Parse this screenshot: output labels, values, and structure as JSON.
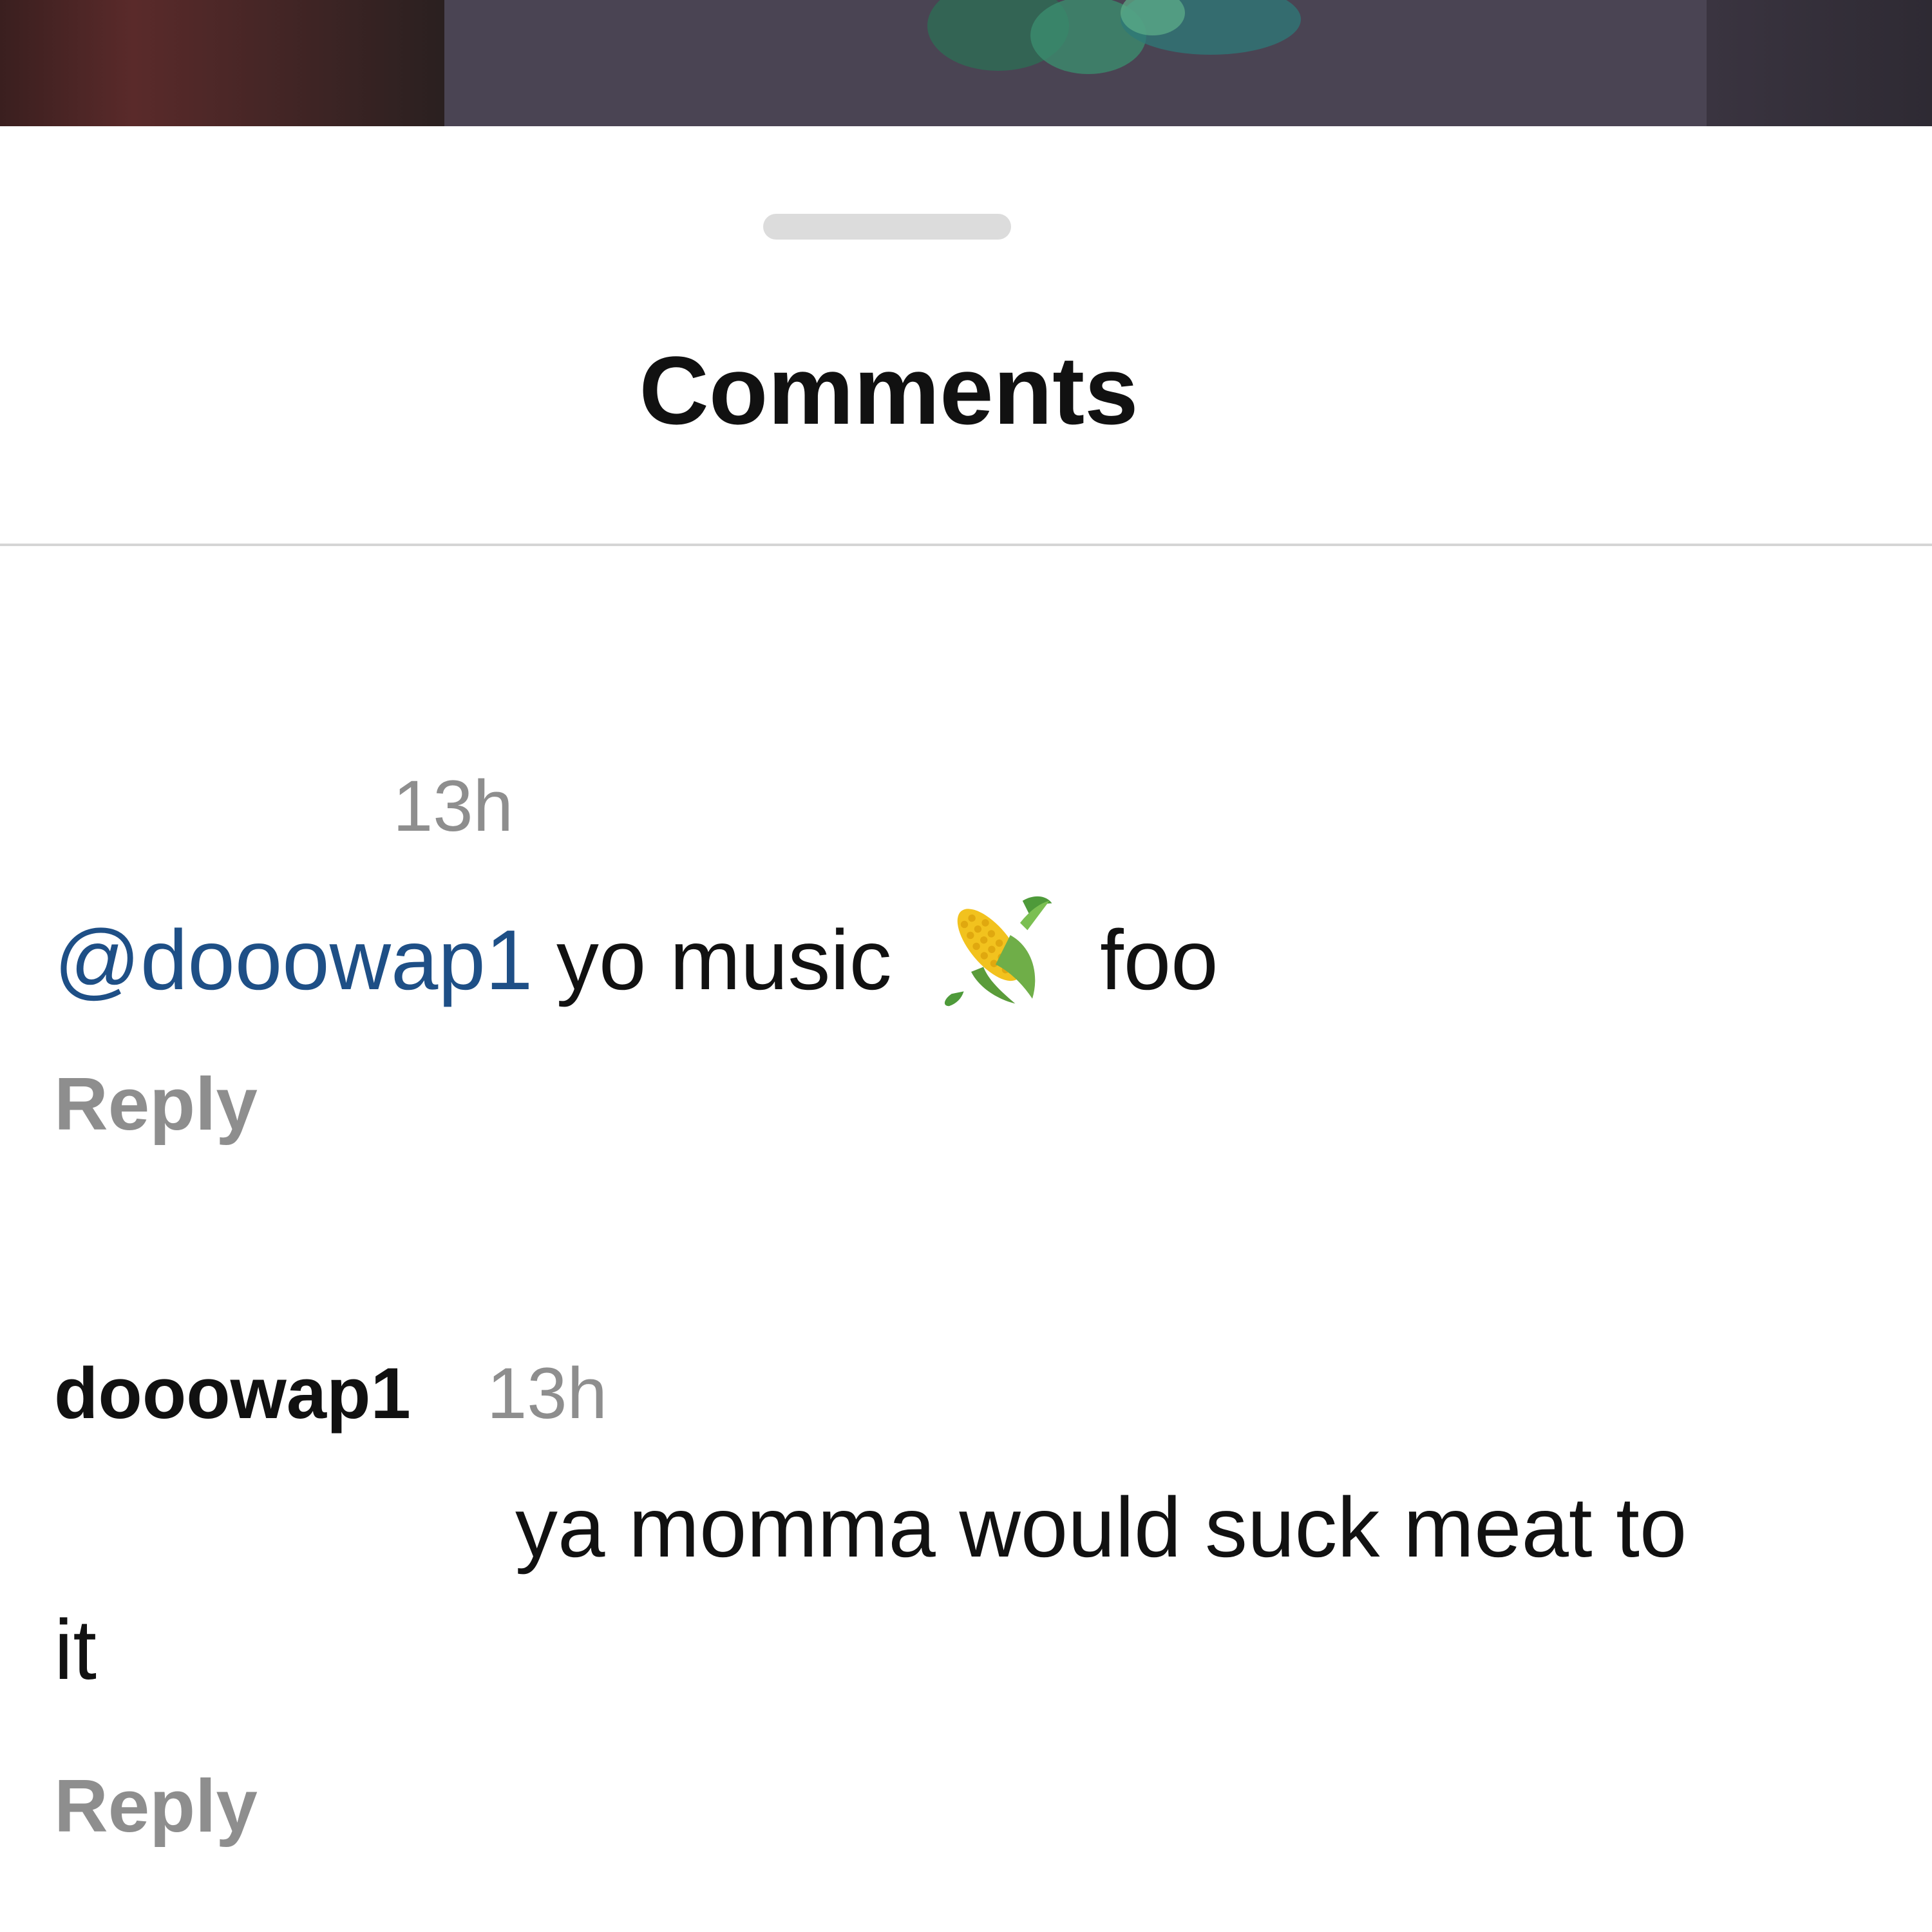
{
  "sheet": {
    "title": "Comments"
  },
  "comments": [
    {
      "timestamp": "13h",
      "mention": "@dooowap1",
      "text_before_emoji": "yo music",
      "emoji": "corn-icon",
      "text_after_emoji": "foo",
      "reply_label": "Reply"
    },
    {
      "username": "dooowap1",
      "timestamp": "13h",
      "text_line1": "ya momma would suck meat to",
      "text_line2": "it",
      "reply_label": "Reply"
    }
  ]
}
